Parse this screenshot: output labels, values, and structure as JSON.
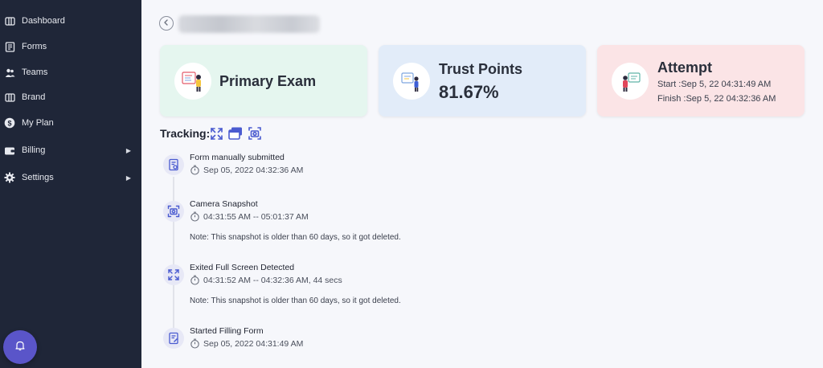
{
  "sidebar": {
    "items": [
      {
        "label": "Dashboard",
        "icon": "dashboard-icon",
        "has_arrow": false
      },
      {
        "label": "Forms",
        "icon": "forms-icon",
        "has_arrow": false
      },
      {
        "label": "Teams",
        "icon": "teams-icon",
        "has_arrow": false
      },
      {
        "label": "Brand",
        "icon": "brand-icon",
        "has_arrow": false
      },
      {
        "label": "My Plan",
        "icon": "dollar-icon",
        "has_arrow": false
      },
      {
        "label": "Billing",
        "icon": "wallet-icon",
        "has_arrow": true,
        "arrow": "▶"
      },
      {
        "label": "Settings",
        "icon": "gear-icon",
        "has_arrow": true,
        "arrow": "▶"
      }
    ],
    "bell_icon": "bell-icon"
  },
  "header": {
    "back_icon": "back-arrow-icon"
  },
  "cards": {
    "primary": {
      "title": "Primary Exam"
    },
    "trust": {
      "title": "Trust Points",
      "value": "81.67%"
    },
    "attempt": {
      "title": "Attempt",
      "start": "Start :Sep 5, 22 04:31:49 AM",
      "finish": "Finish :Sep 5, 22 04:32:36 AM"
    }
  },
  "tracking": {
    "label": "Tracking:",
    "icons": [
      "fullscreen-icon",
      "window-icon",
      "camera-icon"
    ]
  },
  "events": [
    {
      "title": "Form manually submitted",
      "time": "Sep 05, 2022 04:32:36 AM",
      "note": ""
    },
    {
      "title": "Camera Snapshot",
      "time": "04:31:55 AM -- 05:01:37 AM",
      "note": "Note: This snapshot is older than 60 days, so it got deleted."
    },
    {
      "title": "Exited Full Screen Detected",
      "time": "04:31:52 AM -- 04:32:36 AM, 44 secs",
      "note": "Note: This snapshot is older than 60 days, so it got deleted."
    },
    {
      "title": "Started Filling Form",
      "time": "Sep 05, 2022 04:31:49 AM",
      "note": ""
    }
  ],
  "colors": {
    "sidebar_bg": "#1f2638",
    "accent": "#5a55c9",
    "primary_card": "#e5f6ef",
    "trust_card": "#e2ecf9",
    "attempt_card": "#fbe4e6"
  }
}
